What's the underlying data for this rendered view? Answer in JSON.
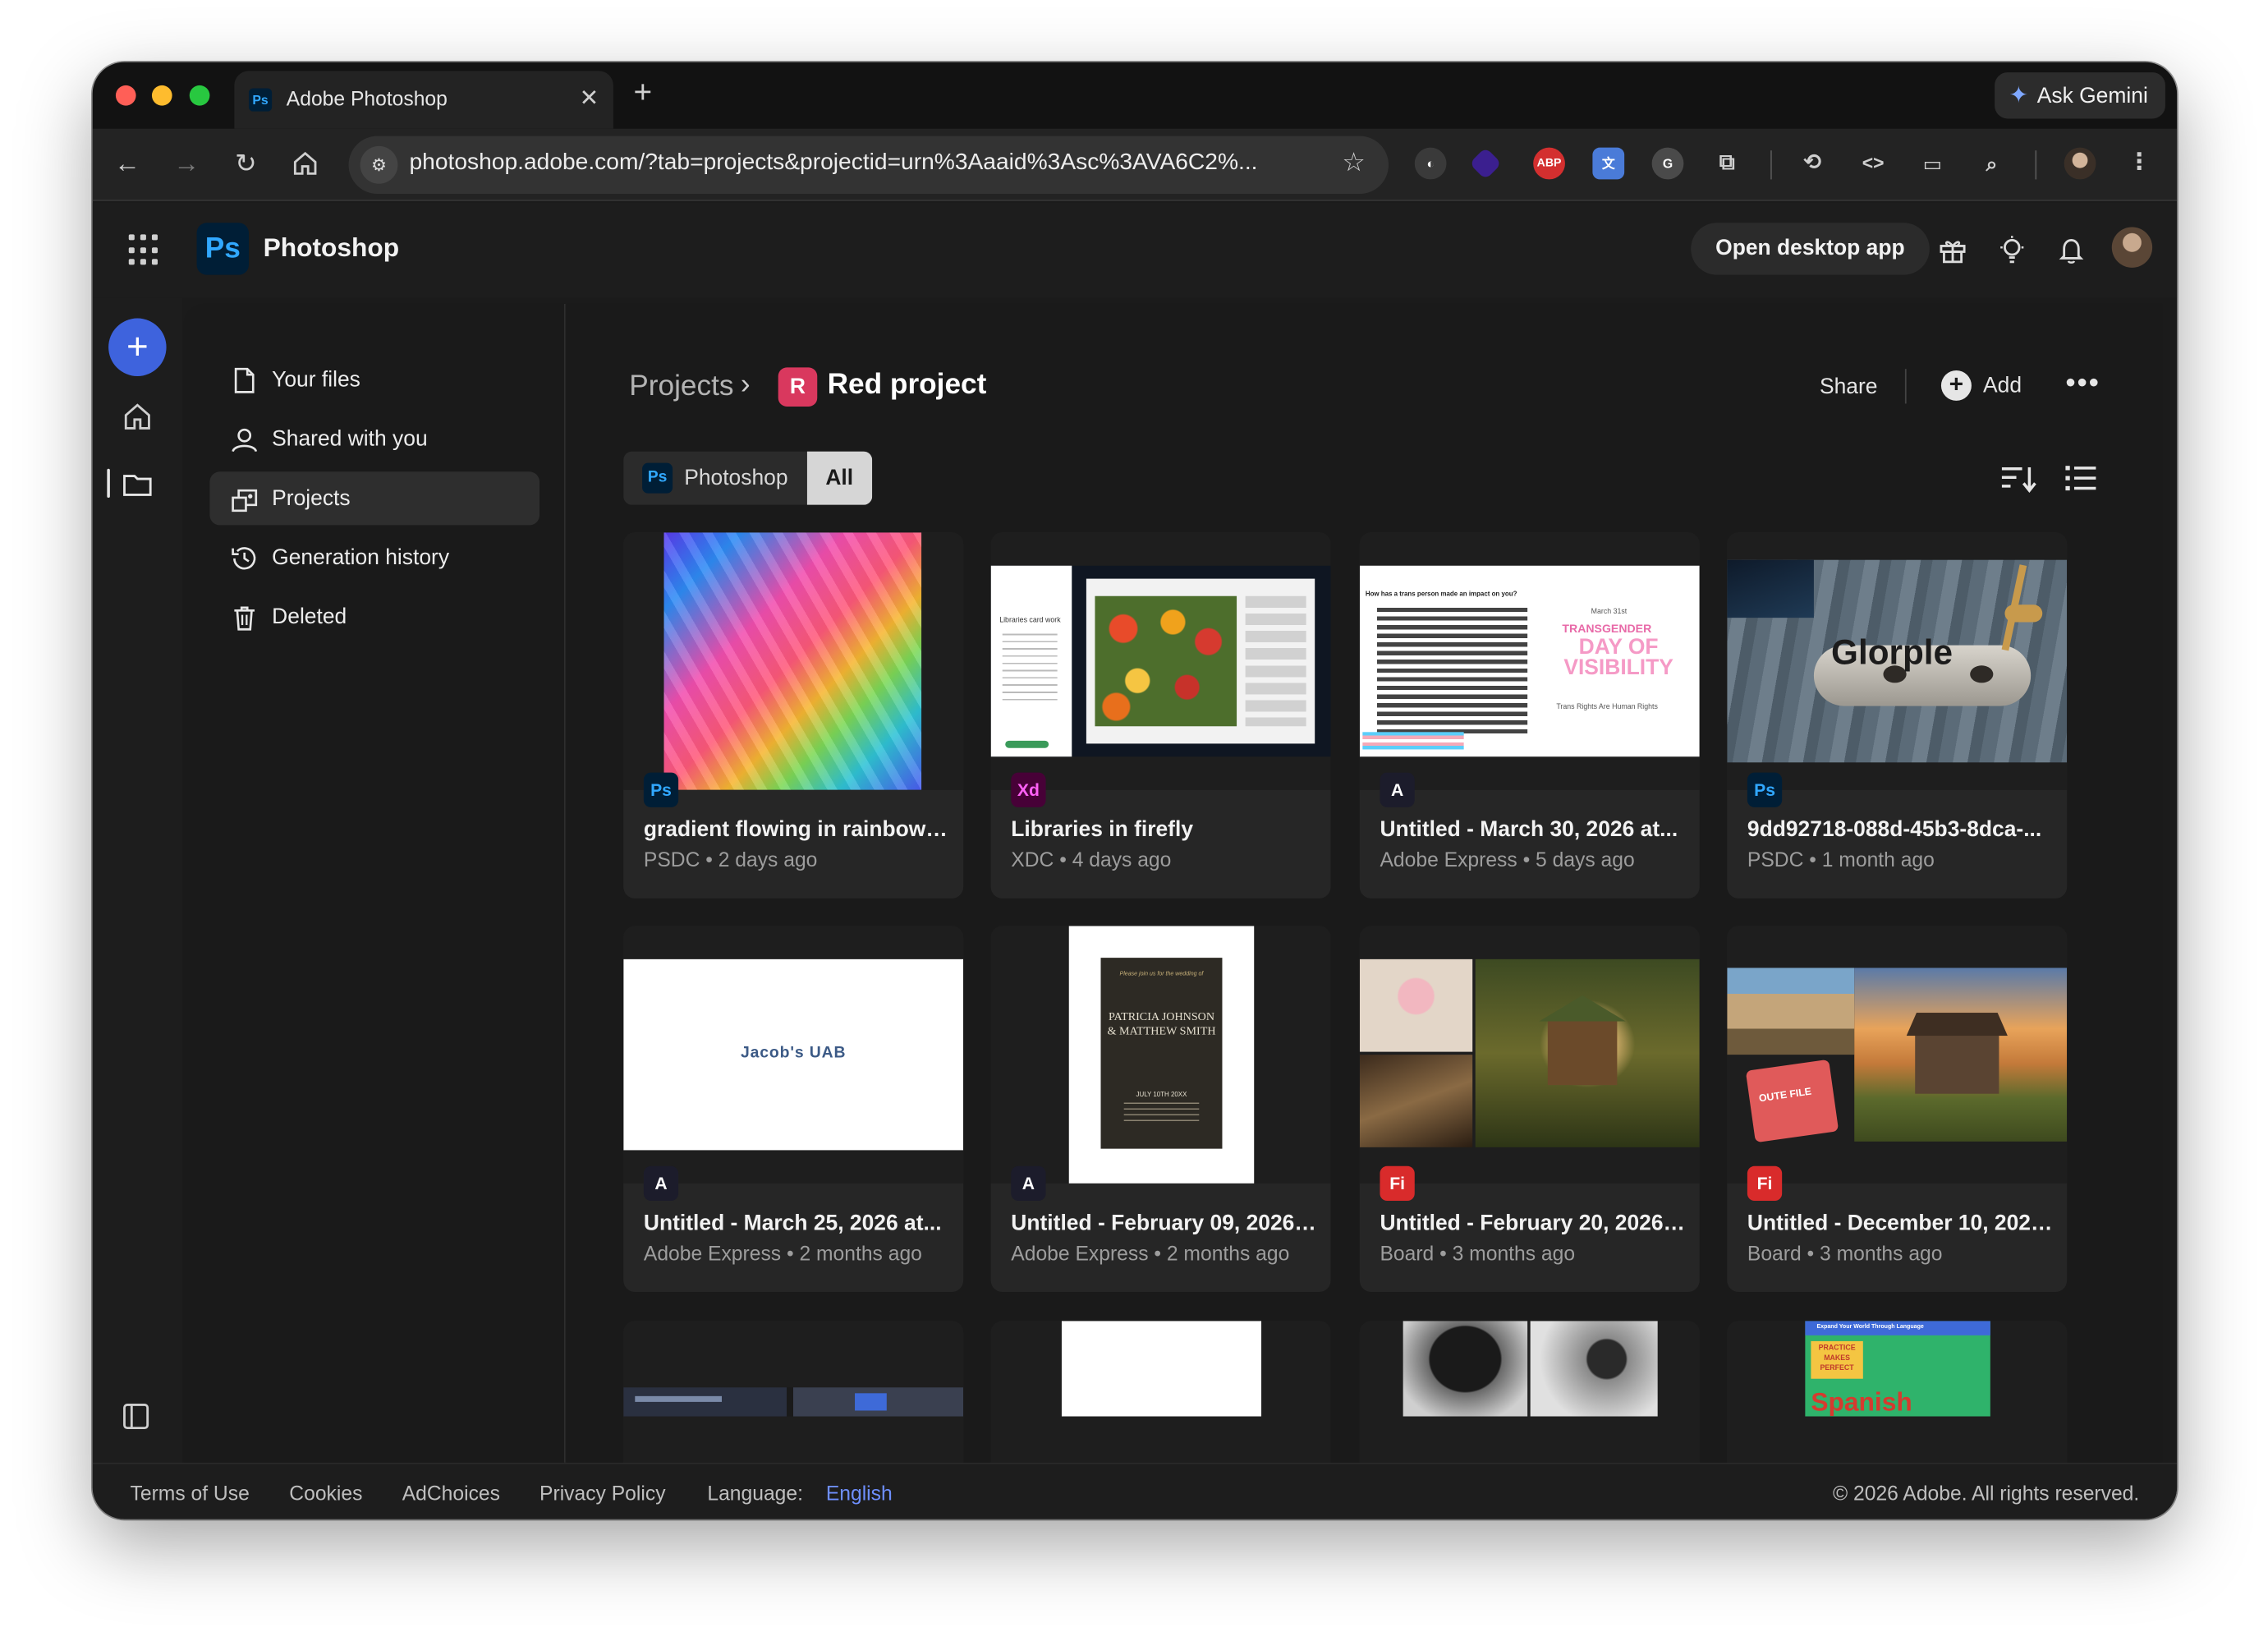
{
  "browser": {
    "tab_title": "Adobe Photoshop",
    "tab_favicon": "Ps",
    "ask_gemini": "Ask Gemini",
    "url": "photoshop.adobe.com/?tab=projects&projectid=urn%3Aaaid%3Asc%3AVA6C2%...",
    "extensions": [
      "lastpass-icon",
      "purple-diamond-icon",
      "ABP",
      "translate-icon",
      "grammarly-icon",
      "puzzle-icon"
    ],
    "abp_label": "ABP"
  },
  "app": {
    "name": "Photoshop",
    "logo_text": "Ps",
    "open_desktop_app": "Open desktop app",
    "header_icons": [
      "gift-icon",
      "lightbulb-icon",
      "bell-icon",
      "avatar"
    ]
  },
  "sidebar": {
    "items": [
      {
        "label": "Your files",
        "icon": "file-icon"
      },
      {
        "label": "Shared with you",
        "icon": "people-icon"
      },
      {
        "label": "Projects",
        "icon": "projects-icon",
        "active": true
      },
      {
        "label": "Generation history",
        "icon": "history-icon"
      },
      {
        "label": "Deleted",
        "icon": "trash-icon"
      }
    ]
  },
  "main": {
    "breadcrumb_root": "Projects",
    "project_badge": "R",
    "project_name": "Red project",
    "share_label": "Share",
    "add_label": "Add",
    "more_label": "•••",
    "filter": {
      "photoshop_label": "Photoshop",
      "photoshop_icon": "Ps",
      "all_label": "All"
    }
  },
  "cards": [
    {
      "name": "gradient flowing in rainbow co...",
      "meta": "PSDC • 2 days ago",
      "app": "Ps"
    },
    {
      "name": "Libraries in firefly",
      "meta": "XDC • 4 days ago",
      "app": "Xd"
    },
    {
      "name": "Untitled - March 30, 2026 at...",
      "meta": "Adobe Express • 5 days ago",
      "app": "A"
    },
    {
      "name": "9dd92718-088d-45b3-8dca-...",
      "meta": "PSDC • 1 month ago",
      "app": "Ps"
    },
    {
      "name": "Untitled - March 25, 2026 at...",
      "meta": "Adobe Express • 2 months ago",
      "app": "A"
    },
    {
      "name": "Untitled - February 09, 2026 at...",
      "meta": "Adobe Express • 2 months ago",
      "app": "A"
    },
    {
      "name": "Untitled - February 20, 2026 at...",
      "meta": "Board • 3 months ago",
      "app": "Fi"
    },
    {
      "name": "Untitled - December 10, 2025 ...",
      "meta": "Board • 3 months ago",
      "app": "Fi"
    }
  ],
  "thumb_text": {
    "glorple": "Glorple",
    "jacob": "Jacob's UAB",
    "wedding_top": "Please join us for the wedding of",
    "wedding_names": "PATRICIA JOHNSON & MATTHEW SMITH",
    "wedding_date": "JULY 10TH 20XX",
    "tdov_date": "March 31st",
    "tdov_title1": "TRANSGENDER",
    "tdov_title2": "DAY OF VISIBILITY",
    "tdov_sub": "Trans Rights Are Human Rights",
    "tdov_head": "How has a trans person made an impact on you?",
    "firefly_left": "Libraries card work",
    "outer_file": "OUTE FILE",
    "spanish_top": "Expand Your World Through Language",
    "practice": "PRACTICE MAKES PERFECT",
    "spanish": "Spanish"
  },
  "footer": {
    "terms": "Terms of Use",
    "cookies": "Cookies",
    "adchoices": "AdChoices",
    "privacy": "Privacy Policy",
    "language_label": "Language:",
    "language_value": "English",
    "copyright": "© 2026 Adobe. All rights reserved."
  },
  "colors": {
    "accent": "#3e63dd",
    "ps_blue": "#31a8ff",
    "project_red": "#d9385e",
    "firefly_red": "#d92b2b"
  }
}
